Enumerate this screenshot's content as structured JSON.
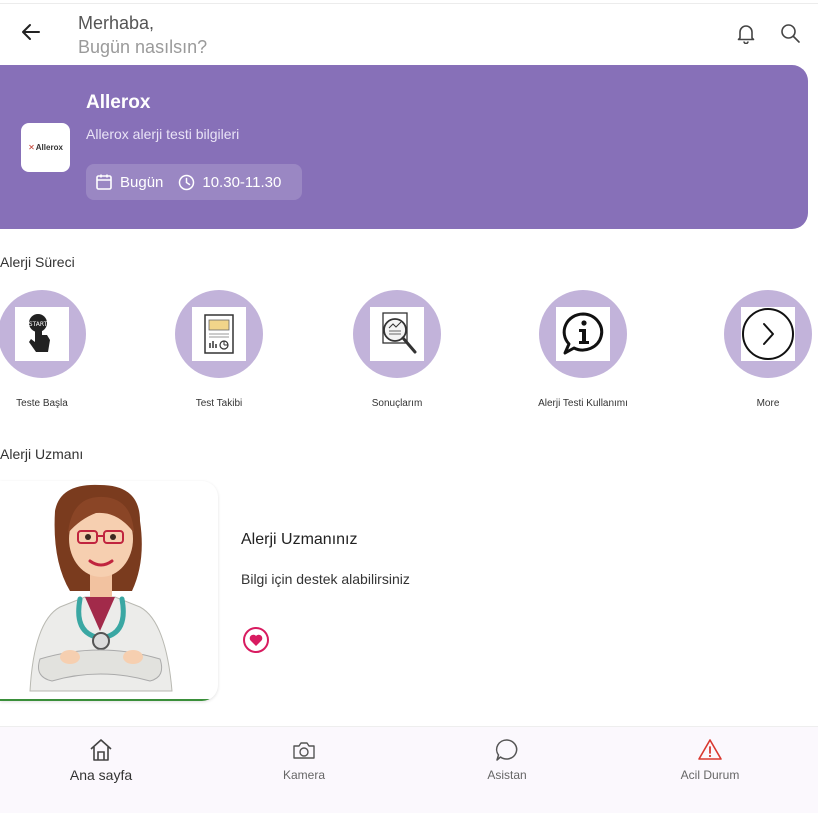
{
  "header": {
    "greeting": "Merhaba,",
    "subgreeting": "Bugün nasılsın?",
    "icons": [
      "back-arrow-icon",
      "bell-icon",
      "search-icon"
    ]
  },
  "banner": {
    "logo_text": "Allerox",
    "title": "Allerox",
    "subtitle": "Allerox alerji testi bilgileri",
    "date_label": "Bugün",
    "time_label": "10.30-11.30",
    "color": "#8770b8"
  },
  "process": {
    "section_title": "Alerji Süreci",
    "items": [
      {
        "label": "Teste Başla",
        "icon": "touch-finger-icon"
      },
      {
        "label": "Test Takibi",
        "icon": "report-icon"
      },
      {
        "label": "Sonuçlarım",
        "icon": "magnifier-document-icon"
      },
      {
        "label": "Alerji Testi Kullanımı",
        "icon": "info-bubble-icon"
      },
      {
        "label": "More",
        "icon": "chevron-right-icon"
      }
    ],
    "circle_color": "#c2b3da"
  },
  "expert": {
    "section_title": "Alerji Uzmanı",
    "title": "Alerji Uzmanınız",
    "description": "Bilgi için destek alabilirsiniz",
    "favorite_icon": "heart-icon",
    "accent": "#d81b60"
  },
  "bottom_nav": {
    "items": [
      {
        "label": "Ana sayfa",
        "icon": "home-icon",
        "active": true
      },
      {
        "label": "Kamera",
        "icon": "camera-icon",
        "active": false
      },
      {
        "label": "Asistan",
        "icon": "chat-icon",
        "active": false
      },
      {
        "label": "Acil Durum",
        "icon": "warning-icon",
        "active": false
      }
    ],
    "warning_color": "#d9382f"
  }
}
